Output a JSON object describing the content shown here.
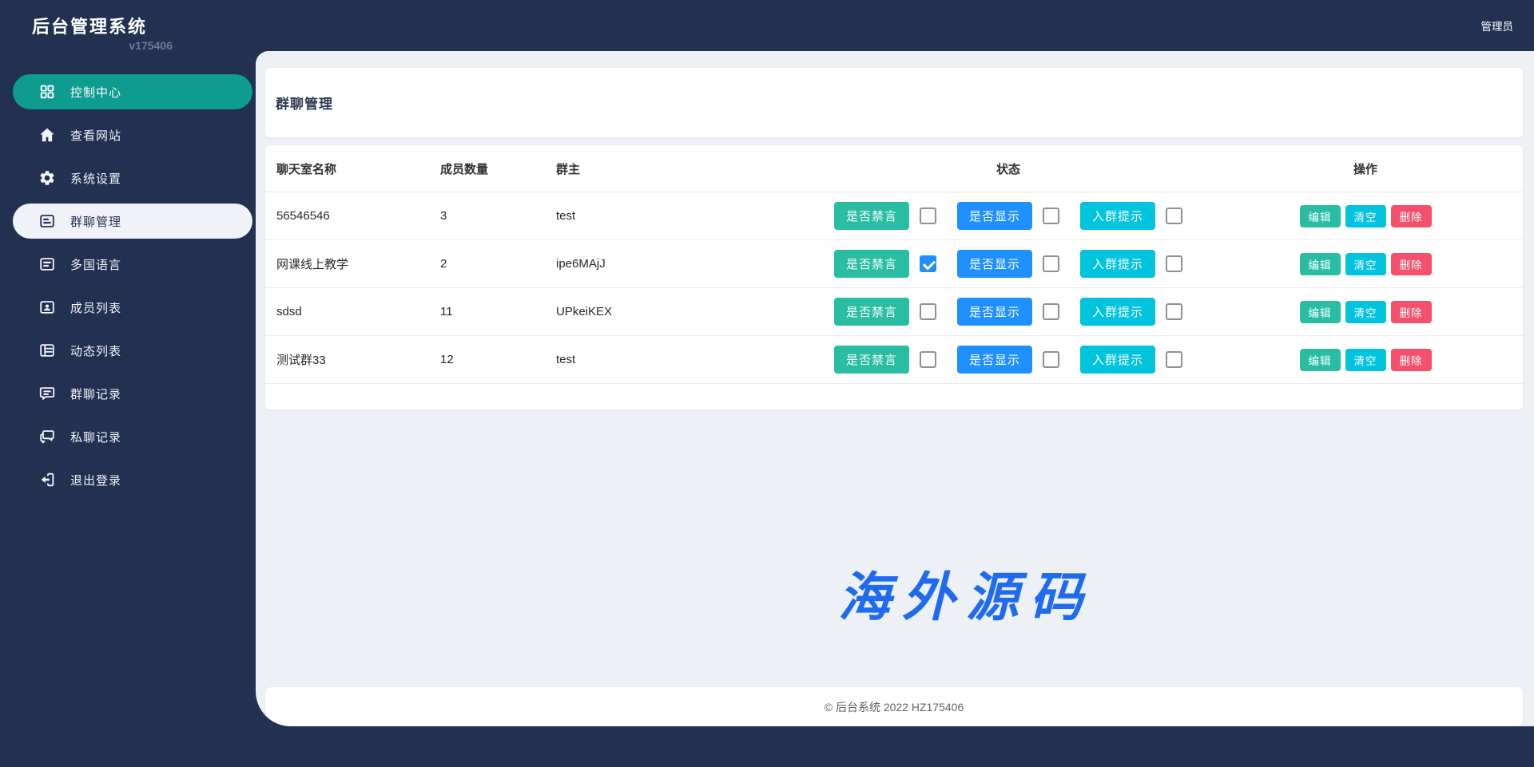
{
  "app": {
    "title": "后台管理系统",
    "version": "v175406",
    "admin_label": "管理员",
    "watermark": "海外源码",
    "footer": "© 后台系统 2022 HZ175406"
  },
  "sidebar": {
    "items": [
      {
        "label": "控制中心",
        "icon": "dashboard-icon",
        "state": "active-teal"
      },
      {
        "label": "查看网站",
        "icon": "home-icon",
        "state": "normal"
      },
      {
        "label": "系统设置",
        "icon": "gear-icon",
        "state": "normal"
      },
      {
        "label": "群聊管理",
        "icon": "group-chat-manage-icon",
        "state": "active-light"
      },
      {
        "label": "多国语言",
        "icon": "language-icon",
        "state": "normal"
      },
      {
        "label": "成员列表",
        "icon": "members-icon",
        "state": "normal"
      },
      {
        "label": "动态列表",
        "icon": "feed-list-icon",
        "state": "normal"
      },
      {
        "label": "群聊记录",
        "icon": "group-chat-log-icon",
        "state": "normal"
      },
      {
        "label": "私聊记录",
        "icon": "private-chat-log-icon",
        "state": "normal"
      },
      {
        "label": "退出登录",
        "icon": "logout-icon",
        "state": "normal"
      }
    ]
  },
  "page": {
    "title": "群聊管理"
  },
  "table": {
    "columns": [
      "聊天室名称",
      "成员数量",
      "群主",
      "状态",
      "操作"
    ],
    "status_buttons": [
      "是否禁言",
      "是否显示",
      "入群提示"
    ],
    "action_buttons": [
      "编辑",
      "清空",
      "删除"
    ],
    "rows": [
      {
        "name": "56546546",
        "members": "3",
        "owner": "test",
        "checks": [
          false,
          false,
          false
        ]
      },
      {
        "name": "网课线上教学",
        "members": "2",
        "owner": "ipe6MAjJ",
        "checks": [
          true,
          false,
          false
        ]
      },
      {
        "name": "sdsd",
        "members": "11",
        "owner": "UPkeiKEX",
        "checks": [
          false,
          false,
          false
        ]
      },
      {
        "name": "测试群33",
        "members": "12",
        "owner": "test",
        "checks": [
          false,
          false,
          false
        ]
      }
    ]
  },
  "colors": {
    "navy": "#223150",
    "sidebar_active_teal": "#0d9c8d",
    "button_teal": "#29bda4",
    "button_blue": "#1e90ff",
    "button_cyan": "#00c3dd",
    "button_red": "#f4516c",
    "watermark_blue": "#1f6bf0",
    "main_background": "#edf0f5"
  }
}
